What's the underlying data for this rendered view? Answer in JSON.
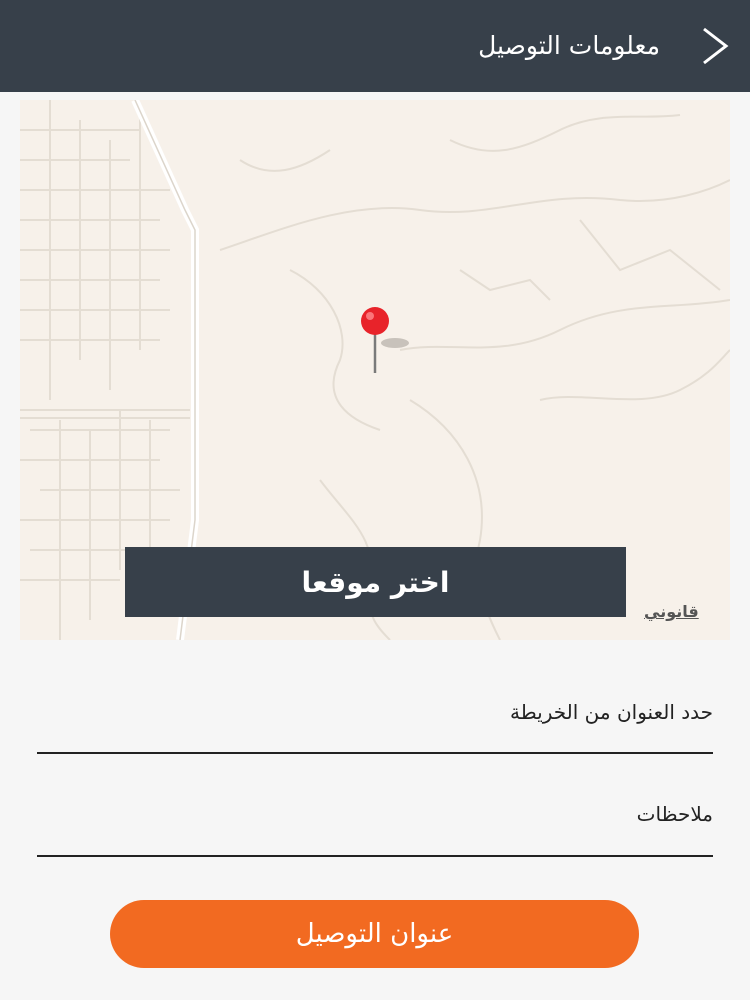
{
  "header": {
    "title": "معلومات التوصيل",
    "back_icon": "chevron-right-icon"
  },
  "map": {
    "pick_location_label": "اختر موقعا",
    "legal_link": "قانوني",
    "pin_icon": "map-pin-icon",
    "pin_color": "#e8232a"
  },
  "form": {
    "address_label": "حدد العنوان من الخريطة",
    "notes_label": "ملاحظات"
  },
  "submit": {
    "label": "عنوان التوصيل",
    "color": "#f26a21"
  },
  "theme": {
    "header_bg": "#37404a",
    "map_bg": "#f7f1ea"
  }
}
